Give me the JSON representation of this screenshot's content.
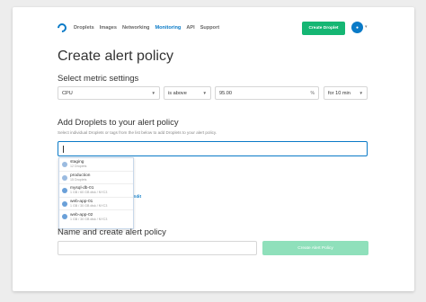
{
  "nav": {
    "links": [
      "Droplets",
      "Images",
      "Networking",
      "Monitoring",
      "API",
      "Support"
    ],
    "active": "Monitoring",
    "create_label": "Create Droplet",
    "accent_color": "#0a7ac7",
    "create_color": "#15b673"
  },
  "page": {
    "title": "Create alert policy"
  },
  "metric": {
    "section_title": "Select metric settings",
    "metric_value": "CPU",
    "comparison_value": "is above",
    "threshold_value": "95.00",
    "threshold_unit": "%",
    "duration_value": "for 10 min"
  },
  "droplets": {
    "section_title": "Add Droplets to your alert policy",
    "helper": "Select individual Droplets or tags from the list below to add Droplets to your alert policy.",
    "search_value": "",
    "edit_label": "Edit",
    "options": [
      {
        "name": "staging",
        "sub": "12 Droplets",
        "kind": "tag"
      },
      {
        "name": "production",
        "sub": "15 Droplets",
        "kind": "tag"
      },
      {
        "name": "mysql-db-01",
        "sub": "1 GB / 60 GB disk / NYC3",
        "kind": "droplet"
      },
      {
        "name": "web-app-01",
        "sub": "1 GB / 30 GB disk / NYC3",
        "kind": "droplet"
      },
      {
        "name": "web-app-02",
        "sub": "1 GB / 30 GB disk / NYC3",
        "kind": "droplet"
      }
    ]
  },
  "create": {
    "section_title": "Name and create alert policy",
    "name_value": "",
    "submit_label": "Create Alert Policy",
    "submit_color": "#8fe0bb"
  }
}
